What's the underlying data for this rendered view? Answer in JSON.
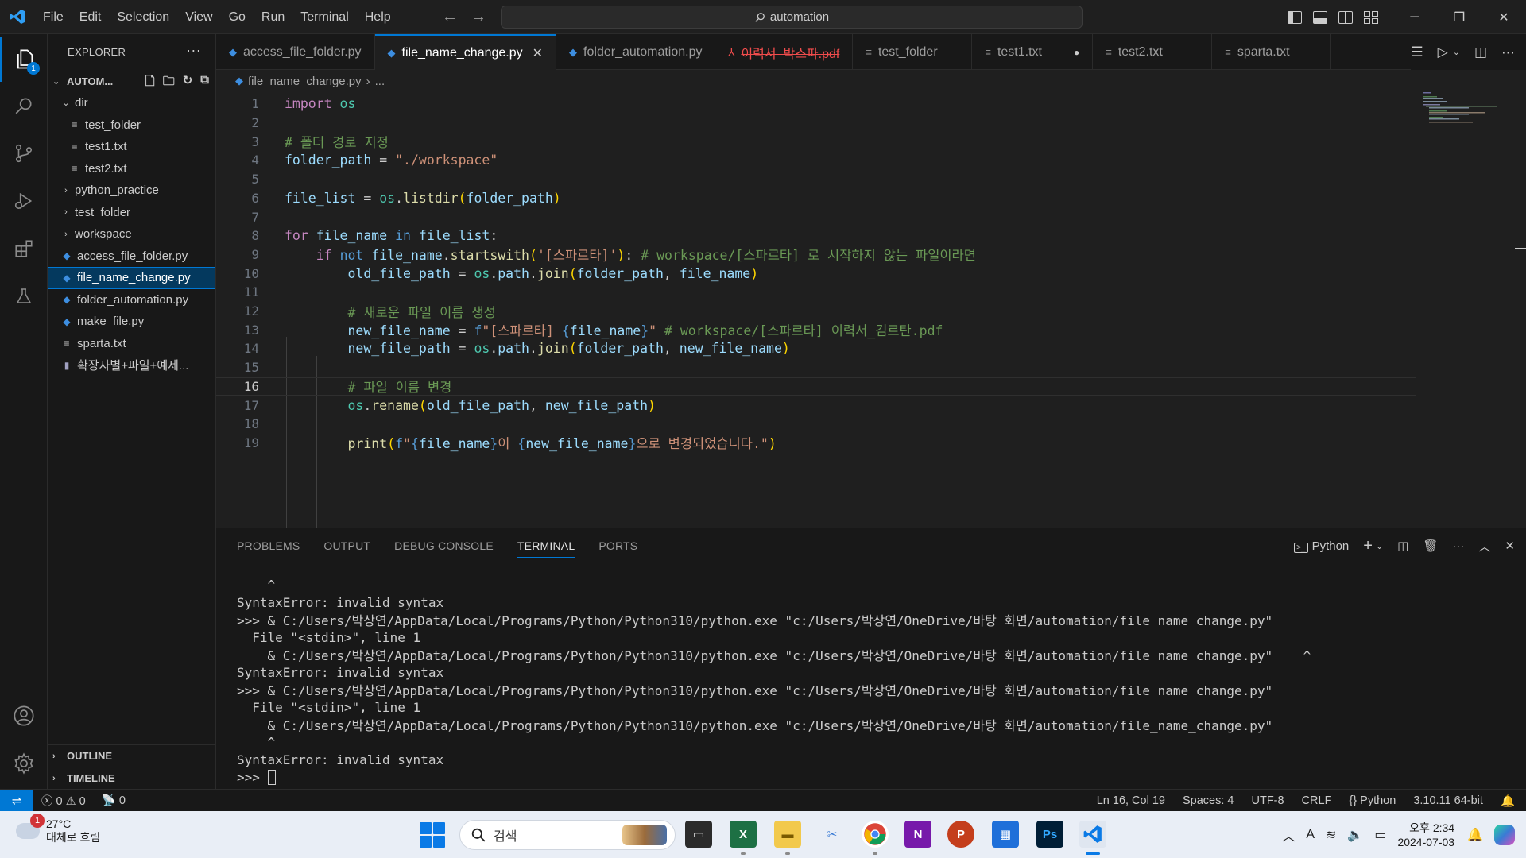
{
  "titlebar": {
    "menu": [
      "File",
      "Edit",
      "Selection",
      "View",
      "Go",
      "Run",
      "Terminal",
      "Help"
    ],
    "search_text": "automation"
  },
  "activity": {
    "explorer_badge": "1"
  },
  "sidebar": {
    "header": "EXPLORER",
    "root": "AUTOM...",
    "items": [
      {
        "label": "dir",
        "type": "folder-open",
        "depth": 1
      },
      {
        "label": "test_folder",
        "type": "txt",
        "depth": 2
      },
      {
        "label": "test1.txt",
        "type": "txt",
        "depth": 2
      },
      {
        "label": "test2.txt",
        "type": "txt",
        "depth": 2
      },
      {
        "label": "python_practice",
        "type": "folder",
        "depth": 1
      },
      {
        "label": "test_folder",
        "type": "folder",
        "depth": 1
      },
      {
        "label": "workspace",
        "type": "folder",
        "depth": 1
      },
      {
        "label": "access_file_folder.py",
        "type": "py",
        "depth": 1
      },
      {
        "label": "file_name_change.py",
        "type": "py",
        "depth": 1,
        "selected": true
      },
      {
        "label": "folder_automation.py",
        "type": "py",
        "depth": 1
      },
      {
        "label": "make_file.py",
        "type": "py",
        "depth": 1
      },
      {
        "label": "sparta.txt",
        "type": "txt",
        "depth": 1
      },
      {
        "label": "확장자별+파일+예제...",
        "type": "zip",
        "depth": 1
      }
    ],
    "outline": "OUTLINE",
    "timeline": "TIMELINE"
  },
  "tabs": [
    {
      "label": "access_file_folder.py",
      "icon": "py"
    },
    {
      "label": "file_name_change.py",
      "icon": "py",
      "active": true
    },
    {
      "label": "folder_automation.py",
      "icon": "py"
    },
    {
      "label": "이력서_박스파.pdf",
      "icon": "pdf",
      "deleted": true
    },
    {
      "label": "test_folder",
      "icon": "txt"
    },
    {
      "label": "test1.txt",
      "icon": "txt",
      "dirty": true
    },
    {
      "label": "test2.txt",
      "icon": "txt"
    },
    {
      "label": "sparta.txt",
      "icon": "txt"
    }
  ],
  "breadcrumb": {
    "file": "file_name_change.py",
    "rest": "..."
  },
  "editor": {
    "current_line": 16,
    "lines": [
      {
        "n": "1",
        "tokens": [
          [
            "kw",
            "import"
          ],
          [
            "",
            "",
            " "
          ],
          [
            "mod",
            "os"
          ]
        ]
      },
      {
        "n": "2",
        "tokens": []
      },
      {
        "n": "3",
        "tokens": [
          [
            "cm",
            "# 폴더 경로 지정"
          ]
        ]
      },
      {
        "n": "4",
        "tokens": [
          [
            "var",
            "folder_path"
          ],
          [
            "",
            " = "
          ],
          [
            "str",
            "\"./workspace\""
          ]
        ]
      },
      {
        "n": "5",
        "tokens": []
      },
      {
        "n": "6",
        "tokens": [
          [
            "var",
            "file_list"
          ],
          [
            "",
            " = "
          ],
          [
            "mod",
            "os"
          ],
          [
            "",
            "."
          ],
          [
            "fn",
            "listdir"
          ],
          [
            "br1",
            "("
          ],
          [
            "var",
            "folder_path"
          ],
          [
            "br1",
            ")"
          ]
        ]
      },
      {
        "n": "7",
        "tokens": []
      },
      {
        "n": "8",
        "tokens": [
          [
            "kw",
            "for"
          ],
          [
            "",
            " "
          ],
          [
            "var",
            "file_name"
          ],
          [
            "",
            " "
          ],
          [
            "kw2",
            "in"
          ],
          [
            "",
            " "
          ],
          [
            "var",
            "file_list"
          ],
          [
            "",
            ":"
          ]
        ]
      },
      {
        "n": "9",
        "tokens": [
          [
            "",
            "    "
          ],
          [
            "kw",
            "if"
          ],
          [
            "",
            " "
          ],
          [
            "kw2",
            "not"
          ],
          [
            "",
            " "
          ],
          [
            "var",
            "file_name"
          ],
          [
            "",
            "."
          ],
          [
            "fn",
            "startswith"
          ],
          [
            "br1",
            "("
          ],
          [
            "str",
            "'[스파르타]'"
          ],
          [
            "br1",
            ")"
          ],
          [
            "",
            ": "
          ],
          [
            "cm",
            "# workspace/[스파르타] 로 시작하지 않는 파일이라면"
          ]
        ]
      },
      {
        "n": "10",
        "tokens": [
          [
            "",
            "        "
          ],
          [
            "var",
            "old_file_path"
          ],
          [
            "",
            " = "
          ],
          [
            "mod",
            "os"
          ],
          [
            "",
            "."
          ],
          [
            "var",
            "path"
          ],
          [
            "",
            "."
          ],
          [
            "fn",
            "join"
          ],
          [
            "br1",
            "("
          ],
          [
            "var",
            "folder_path"
          ],
          [
            "",
            ", "
          ],
          [
            "var",
            "file_name"
          ],
          [
            "br1",
            ")"
          ]
        ]
      },
      {
        "n": "11",
        "tokens": []
      },
      {
        "n": "12",
        "tokens": [
          [
            "",
            "        "
          ],
          [
            "cm",
            "# 새로운 파일 이름 생성"
          ]
        ]
      },
      {
        "n": "13",
        "tokens": [
          [
            "",
            "        "
          ],
          [
            "var",
            "new_file_name"
          ],
          [
            "",
            " = "
          ],
          [
            "kw2",
            "f"
          ],
          [
            "str",
            "\"[스파르타] "
          ],
          [
            "fmt",
            "{"
          ],
          [
            "var",
            "file_name"
          ],
          [
            "fmt",
            "}"
          ],
          [
            "str",
            "\""
          ],
          [
            "",
            " "
          ],
          [
            "cm",
            "# workspace/[스파르타] 이력서_김르탄.pdf"
          ]
        ]
      },
      {
        "n": "14",
        "tokens": [
          [
            "",
            "        "
          ],
          [
            "var",
            "new_file_path"
          ],
          [
            "",
            " = "
          ],
          [
            "mod",
            "os"
          ],
          [
            "",
            "."
          ],
          [
            "var",
            "path"
          ],
          [
            "",
            "."
          ],
          [
            "fn",
            "join"
          ],
          [
            "br1",
            "("
          ],
          [
            "var",
            "folder_path"
          ],
          [
            "",
            ", "
          ],
          [
            "var",
            "new_file_name"
          ],
          [
            "br1",
            ")"
          ]
        ]
      },
      {
        "n": "15",
        "tokens": []
      },
      {
        "n": "16",
        "tokens": [
          [
            "",
            "        "
          ],
          [
            "cm",
            "# 파일 이름 변경"
          ]
        ]
      },
      {
        "n": "17",
        "tokens": [
          [
            "",
            "        "
          ],
          [
            "mod",
            "os"
          ],
          [
            "",
            "."
          ],
          [
            "fn",
            "rename"
          ],
          [
            "br1",
            "("
          ],
          [
            "var",
            "old_file_path"
          ],
          [
            "",
            ", "
          ],
          [
            "var",
            "new_file_path"
          ],
          [
            "br1",
            ")"
          ]
        ]
      },
      {
        "n": "18",
        "tokens": []
      },
      {
        "n": "19",
        "tokens": [
          [
            "",
            "        "
          ],
          [
            "fn",
            "print"
          ],
          [
            "br1",
            "("
          ],
          [
            "kw2",
            "f"
          ],
          [
            "str",
            "\""
          ],
          [
            "fmt",
            "{"
          ],
          [
            "var",
            "file_name"
          ],
          [
            "fmt",
            "}"
          ],
          [
            "str",
            "이 "
          ],
          [
            "fmt",
            "{"
          ],
          [
            "var",
            "new_file_name"
          ],
          [
            "fmt",
            "}"
          ],
          [
            "str",
            "으로 변경되었습니다.\""
          ],
          [
            "br1",
            ")"
          ]
        ]
      }
    ]
  },
  "panel": {
    "tabs": [
      "PROBLEMS",
      "OUTPUT",
      "DEBUG CONSOLE",
      "TERMINAL",
      "PORTS"
    ],
    "active_tab": "TERMINAL",
    "shell": "Python",
    "terminal_lines": [
      "    ^",
      "SyntaxError: invalid syntax",
      ">>> & C:/Users/박상연/AppData/Local/Programs/Python/Python310/python.exe \"c:/Users/박상연/OneDrive/바탕 화면/automation/file_name_change.py\"",
      "  File \"<stdin>\", line 1",
      "    & C:/Users/박상연/AppData/Local/Programs/Python/Python310/python.exe \"c:/Users/박상연/OneDrive/바탕 화면/automation/file_name_change.py\"    ^",
      "SyntaxError: invalid syntax",
      ">>> & C:/Users/박상연/AppData/Local/Programs/Python/Python310/python.exe \"c:/Users/박상연/OneDrive/바탕 화면/automation/file_name_change.py\"",
      "  File \"<stdin>\", line 1",
      "    & C:/Users/박상연/AppData/Local/Programs/Python/Python310/python.exe \"c:/Users/박상연/OneDrive/바탕 화면/automation/file_name_change.py\"",
      "    ^",
      "SyntaxError: invalid syntax"
    ],
    "prompt": ">>> "
  },
  "statusbar": {
    "errors": "0",
    "warnings": "0",
    "ports": "0",
    "position": "Ln 16, Col 19",
    "spaces": "Spaces: 4",
    "encoding": "UTF-8",
    "eol": "CRLF",
    "language": "Python",
    "interpreter": "3.10.11 64-bit"
  },
  "taskbar": {
    "weather_badge": "1",
    "temperature": "27°C",
    "weather_desc": "대체로 흐림",
    "search_placeholder": "검색",
    "time": "오후 2:34",
    "date": "2024-07-03",
    "colors": {
      "accent": "#0078d4",
      "excel": "#1d7044",
      "onenote": "#7719aa",
      "powerpoint": "#c43e1c",
      "photoshop": "#001e36"
    }
  }
}
